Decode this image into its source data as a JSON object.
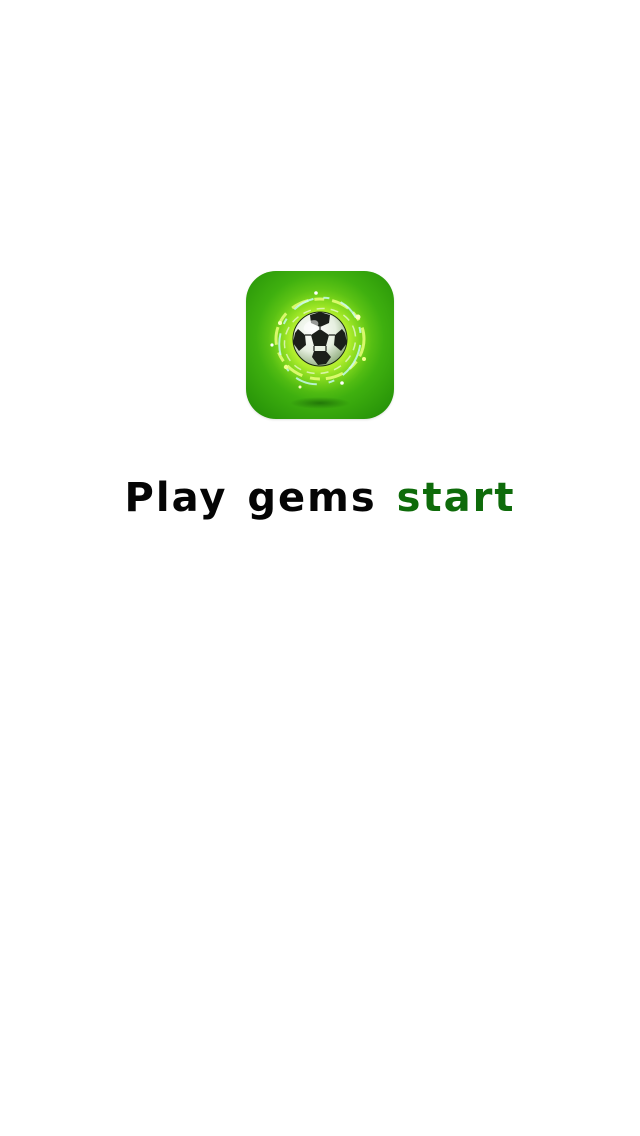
{
  "splash": {
    "icon": {
      "name": "soccer-ball-icon",
      "colors": {
        "background_light": "#b6f23a",
        "background_dark": "#1f8a06",
        "glow": "#eaff7a",
        "swirl": "#c9fbff"
      }
    },
    "title": {
      "word1": "Play",
      "word2": "gems",
      "word3": "start"
    },
    "colors": {
      "title_dark": "#050505",
      "title_accent": "#0e6b0a",
      "background": "#ffffff"
    }
  }
}
